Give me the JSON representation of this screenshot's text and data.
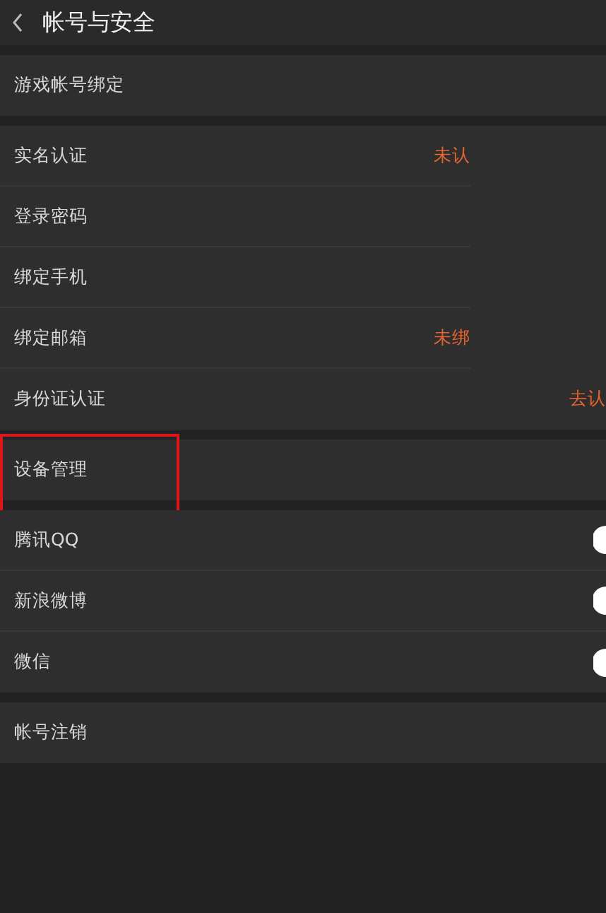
{
  "header": {
    "title": "帐号与安全"
  },
  "sections": [
    {
      "rows": [
        {
          "kind": "link",
          "label": "游戏帐号绑定"
        }
      ]
    },
    {
      "rows": [
        {
          "kind": "status",
          "label": "实名认证",
          "status": "未认"
        },
        {
          "kind": "link",
          "label": "登录密码"
        },
        {
          "kind": "link",
          "label": "绑定手机"
        },
        {
          "kind": "status",
          "label": "绑定邮箱",
          "status": "未绑"
        },
        {
          "kind": "status",
          "label": "身份证认证",
          "status": "去认"
        }
      ]
    },
    {
      "rows": [
        {
          "kind": "link",
          "label": "设备管理",
          "highlighted": true
        }
      ]
    },
    {
      "rows": [
        {
          "kind": "toggle",
          "label": "腾讯QQ"
        },
        {
          "kind": "toggle",
          "label": "新浪微博"
        },
        {
          "kind": "toggle",
          "label": "微信"
        }
      ]
    },
    {
      "rows": [
        {
          "kind": "link",
          "label": "帐号注销"
        }
      ]
    }
  ]
}
